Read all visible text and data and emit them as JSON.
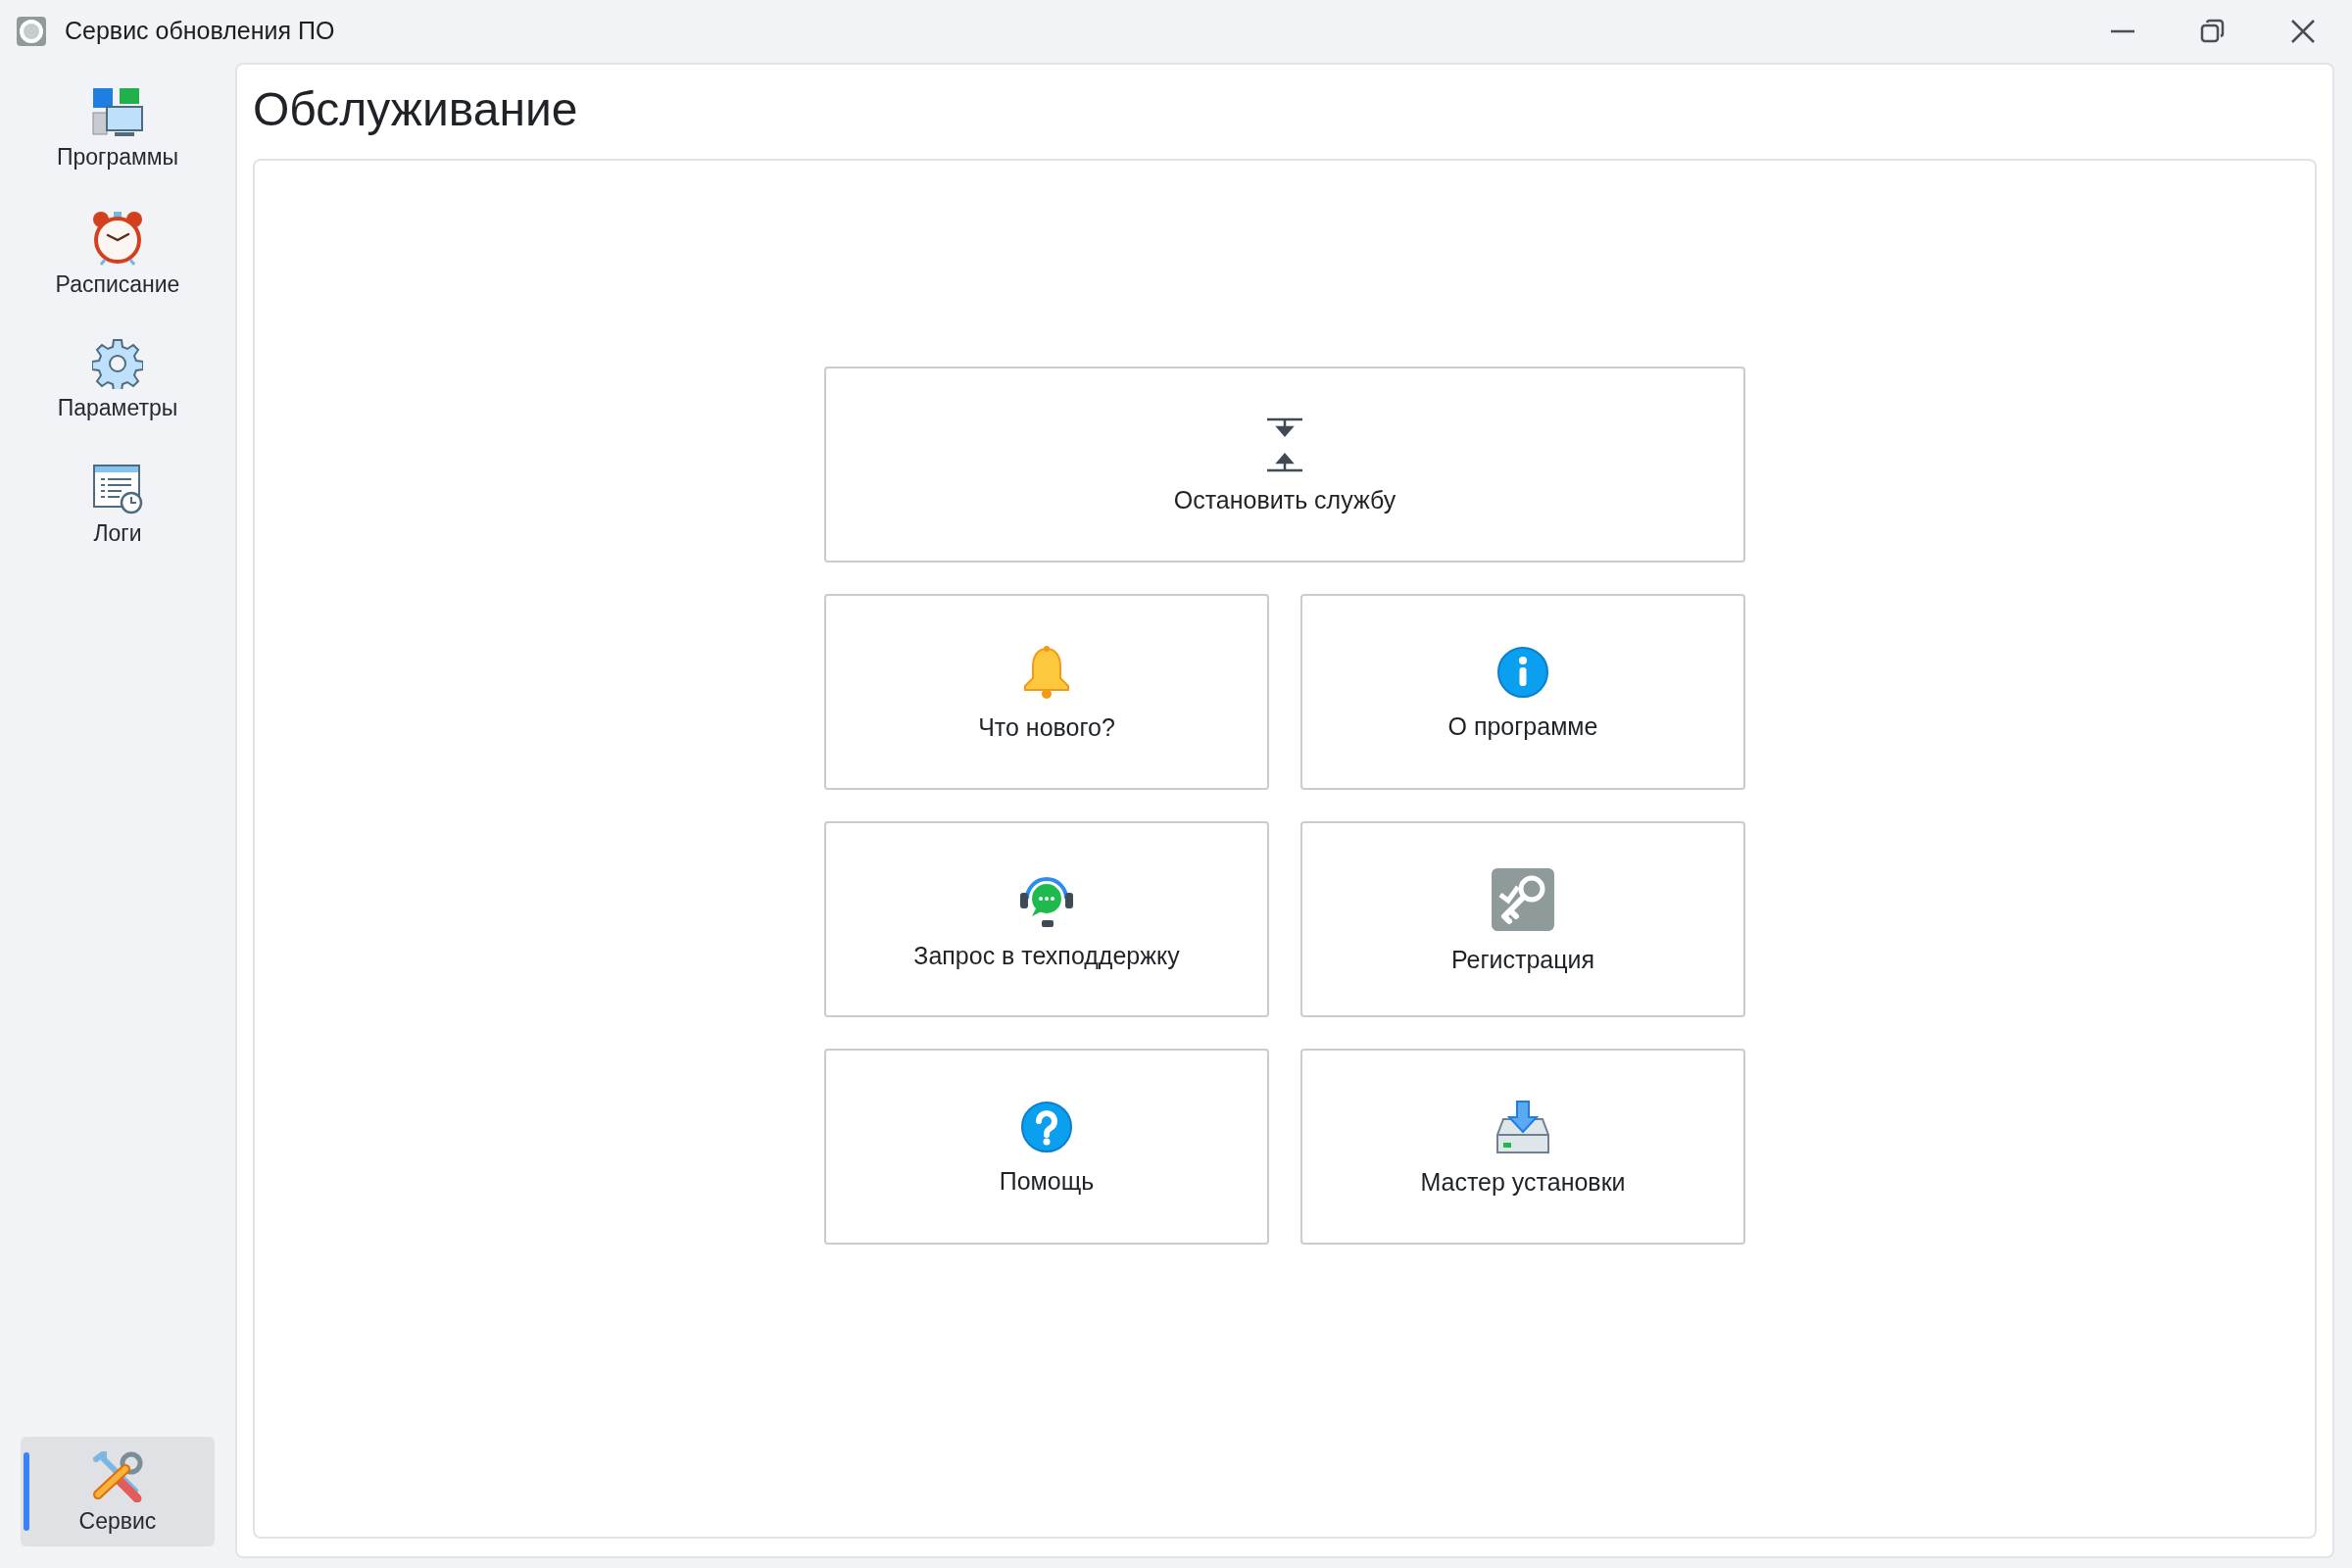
{
  "window": {
    "title": "Сервис обновления ПО"
  },
  "sidebar": {
    "items": [
      {
        "label": "Программы",
        "selected": false
      },
      {
        "label": "Расписание",
        "selected": false
      },
      {
        "label": "Параметры",
        "selected": false
      },
      {
        "label": "Логи",
        "selected": false
      }
    ],
    "bottom_items": [
      {
        "label": "Сервис",
        "selected": true
      }
    ]
  },
  "page": {
    "title": "Обслуживание",
    "actions": [
      {
        "label": "Остановить службу"
      },
      {
        "label": "Что нового?"
      },
      {
        "label": "О программе"
      },
      {
        "label": "Запрос в техподдержку"
      },
      {
        "label": "Регистрация"
      },
      {
        "label": "Помощь"
      },
      {
        "label": "Мастер установки"
      }
    ]
  }
}
